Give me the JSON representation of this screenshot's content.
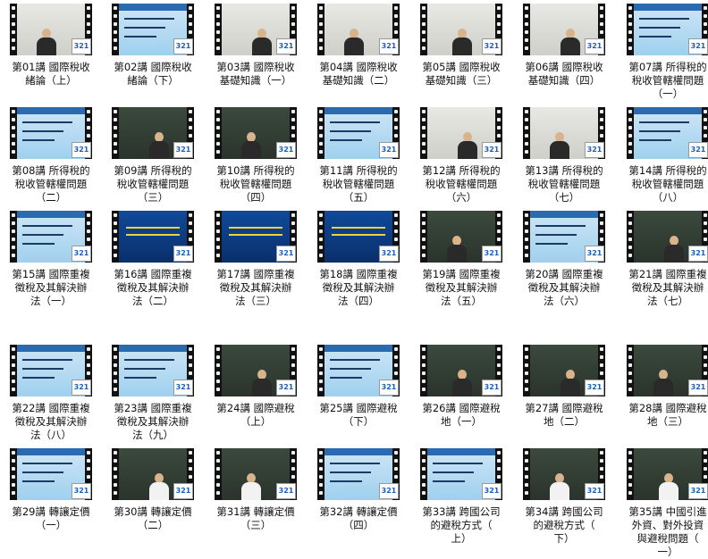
{
  "badge_label": "321",
  "colors": {
    "title_text": "#111111",
    "background": "#ffffff",
    "badge_text": "#1a5fc0"
  },
  "icons": {
    "film_strip": "film-strip-icon",
    "badge": "321-badge-icon"
  },
  "lessons": [
    {
      "title": "第01講 國際稅收\n緒論（上）",
      "scene": "lecture-light"
    },
    {
      "title": "第02講 國際稅收\n緒論（下）",
      "scene": "slide"
    },
    {
      "title": "第03講 國際稅收\n基礎知識（一）",
      "scene": "lecture-light"
    },
    {
      "title": "第04講 國際稅收\n基礎知識（二）",
      "scene": "lecture-light"
    },
    {
      "title": "第05講 國際稅收\n基礎知識（三）",
      "scene": "lecture-light"
    },
    {
      "title": "第06講 國際稅收\n基礎知識（四）",
      "scene": "lecture-light"
    },
    {
      "title": "第07講 所得稅的\n稅收管轄權問題\n（一）",
      "scene": "slide"
    },
    {
      "title": "第08講 所得稅的\n稅收管轄權問題\n（二）",
      "scene": "slide"
    },
    {
      "title": "第09講 所得稅的\n稅收管轄權問題\n（三）",
      "scene": "lecture"
    },
    {
      "title": "第10講 所得稅的\n稅收管轄權問題\n（四）",
      "scene": "lecture"
    },
    {
      "title": "第11講 所得稅的\n稅收管轄權問題\n（五）",
      "scene": "slide"
    },
    {
      "title": "第12講 所得稅的\n稅收管轄權問題\n（六）",
      "scene": "lecture-light"
    },
    {
      "title": "第13講 所得稅的\n稅收管轄權問題\n（七）",
      "scene": "lecture-light"
    },
    {
      "title": "第14講 所得稅的\n稅收管轄權問題\n（八）",
      "scene": "slide"
    },
    {
      "title": "第15講 國際重複\n徵稅及其解決辦\n法（一）",
      "scene": "slide"
    },
    {
      "title": "第16講 國際重複\n徵稅及其解決辦\n法（二）",
      "scene": "dark"
    },
    {
      "title": "第17講 國際重複\n徵稅及其解決辦\n法（三）",
      "scene": "dark"
    },
    {
      "title": "第18講 國際重複\n徵稅及其解決辦\n法（四）",
      "scene": "dark"
    },
    {
      "title": "第19講 國際重複\n徵稅及其解決辦\n法（五）",
      "scene": "lecture"
    },
    {
      "title": "第20講 國際重複\n徵稅及其解決辦\n法（六）",
      "scene": "slide"
    },
    {
      "title": "第21講 國際重複\n徵稅及其解決辦\n法（七）",
      "scene": "lecture"
    },
    {
      "title": "第22講 國際重複\n徵稅及其解決辦\n法（八）",
      "scene": "slide"
    },
    {
      "title": "第23講 國際重複\n徵稅及其解決辦\n法（九）",
      "scene": "slide"
    },
    {
      "title": "第24講 國際避稅\n（上）",
      "scene": "lecture"
    },
    {
      "title": "第25講 國際避稅\n（下）",
      "scene": "slide"
    },
    {
      "title": "第26講 國際避稅\n地（一）",
      "scene": "lecture"
    },
    {
      "title": "第27講 國際避稅\n地（二）",
      "scene": "lecture"
    },
    {
      "title": "第28講 國際避稅\n地（三）",
      "scene": "lecture"
    },
    {
      "title": "第29講 轉讓定價\n（一）",
      "scene": "slide"
    },
    {
      "title": "第30講 轉讓定價\n（二）",
      "scene": "lecture-white"
    },
    {
      "title": "第31講 轉讓定價\n（三）",
      "scene": "lecture-white"
    },
    {
      "title": "第32講 轉讓定價\n（四）",
      "scene": "slide"
    },
    {
      "title": "第33講 跨國公司\n的避稅方式（\n上）",
      "scene": "slide"
    },
    {
      "title": "第34講 跨國公司\n的避稅方式（\n下）",
      "scene": "lecture-white"
    },
    {
      "title": "第35講 中國引進\n外資、對外投資\n與避稅問題（\n一）",
      "scene": "lecture-white"
    }
  ]
}
